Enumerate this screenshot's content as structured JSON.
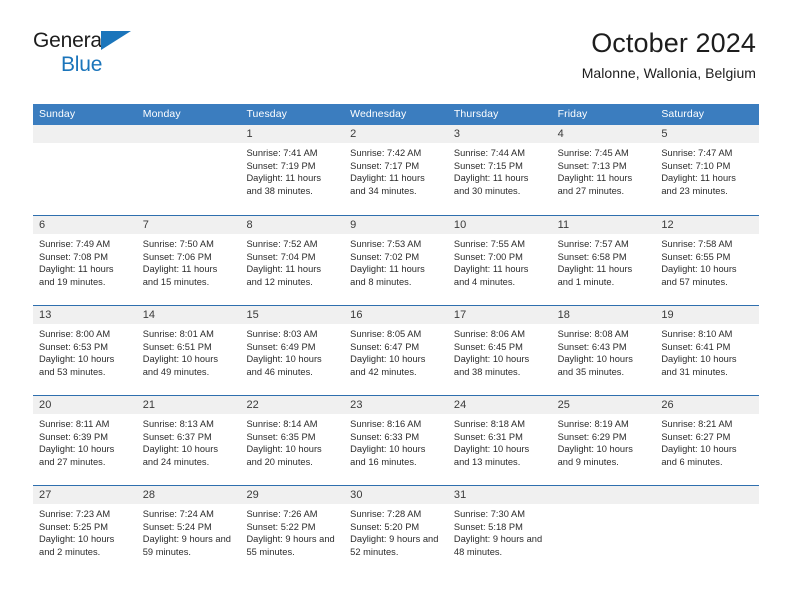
{
  "brand": {
    "name_top": "General",
    "name_bottom": "Blue",
    "accent_color": "#1b75bb"
  },
  "header": {
    "title": "October 2024",
    "subtitle": "Malonne, Wallonia, Belgium"
  },
  "calendar": {
    "header_bg": "#3b7dbf",
    "date_band_bg": "#f0f0f0",
    "weekdays": [
      "Sunday",
      "Monday",
      "Tuesday",
      "Wednesday",
      "Thursday",
      "Friday",
      "Saturday"
    ],
    "weeks": [
      [
        {
          "day": "",
          "empty": true
        },
        {
          "day": "",
          "empty": true
        },
        {
          "day": "1",
          "sunrise": "Sunrise: 7:41 AM",
          "sunset": "Sunset: 7:19 PM",
          "daylight": "Daylight: 11 hours and 38 minutes."
        },
        {
          "day": "2",
          "sunrise": "Sunrise: 7:42 AM",
          "sunset": "Sunset: 7:17 PM",
          "daylight": "Daylight: 11 hours and 34 minutes."
        },
        {
          "day": "3",
          "sunrise": "Sunrise: 7:44 AM",
          "sunset": "Sunset: 7:15 PM",
          "daylight": "Daylight: 11 hours and 30 minutes."
        },
        {
          "day": "4",
          "sunrise": "Sunrise: 7:45 AM",
          "sunset": "Sunset: 7:13 PM",
          "daylight": "Daylight: 11 hours and 27 minutes."
        },
        {
          "day": "5",
          "sunrise": "Sunrise: 7:47 AM",
          "sunset": "Sunset: 7:10 PM",
          "daylight": "Daylight: 11 hours and 23 minutes."
        }
      ],
      [
        {
          "day": "6",
          "sunrise": "Sunrise: 7:49 AM",
          "sunset": "Sunset: 7:08 PM",
          "daylight": "Daylight: 11 hours and 19 minutes."
        },
        {
          "day": "7",
          "sunrise": "Sunrise: 7:50 AM",
          "sunset": "Sunset: 7:06 PM",
          "daylight": "Daylight: 11 hours and 15 minutes."
        },
        {
          "day": "8",
          "sunrise": "Sunrise: 7:52 AM",
          "sunset": "Sunset: 7:04 PM",
          "daylight": "Daylight: 11 hours and 12 minutes."
        },
        {
          "day": "9",
          "sunrise": "Sunrise: 7:53 AM",
          "sunset": "Sunset: 7:02 PM",
          "daylight": "Daylight: 11 hours and 8 minutes."
        },
        {
          "day": "10",
          "sunrise": "Sunrise: 7:55 AM",
          "sunset": "Sunset: 7:00 PM",
          "daylight": "Daylight: 11 hours and 4 minutes."
        },
        {
          "day": "11",
          "sunrise": "Sunrise: 7:57 AM",
          "sunset": "Sunset: 6:58 PM",
          "daylight": "Daylight: 11 hours and 1 minute."
        },
        {
          "day": "12",
          "sunrise": "Sunrise: 7:58 AM",
          "sunset": "Sunset: 6:55 PM",
          "daylight": "Daylight: 10 hours and 57 minutes."
        }
      ],
      [
        {
          "day": "13",
          "sunrise": "Sunrise: 8:00 AM",
          "sunset": "Sunset: 6:53 PM",
          "daylight": "Daylight: 10 hours and 53 minutes."
        },
        {
          "day": "14",
          "sunrise": "Sunrise: 8:01 AM",
          "sunset": "Sunset: 6:51 PM",
          "daylight": "Daylight: 10 hours and 49 minutes."
        },
        {
          "day": "15",
          "sunrise": "Sunrise: 8:03 AM",
          "sunset": "Sunset: 6:49 PM",
          "daylight": "Daylight: 10 hours and 46 minutes."
        },
        {
          "day": "16",
          "sunrise": "Sunrise: 8:05 AM",
          "sunset": "Sunset: 6:47 PM",
          "daylight": "Daylight: 10 hours and 42 minutes."
        },
        {
          "day": "17",
          "sunrise": "Sunrise: 8:06 AM",
          "sunset": "Sunset: 6:45 PM",
          "daylight": "Daylight: 10 hours and 38 minutes."
        },
        {
          "day": "18",
          "sunrise": "Sunrise: 8:08 AM",
          "sunset": "Sunset: 6:43 PM",
          "daylight": "Daylight: 10 hours and 35 minutes."
        },
        {
          "day": "19",
          "sunrise": "Sunrise: 8:10 AM",
          "sunset": "Sunset: 6:41 PM",
          "daylight": "Daylight: 10 hours and 31 minutes."
        }
      ],
      [
        {
          "day": "20",
          "sunrise": "Sunrise: 8:11 AM",
          "sunset": "Sunset: 6:39 PM",
          "daylight": "Daylight: 10 hours and 27 minutes."
        },
        {
          "day": "21",
          "sunrise": "Sunrise: 8:13 AM",
          "sunset": "Sunset: 6:37 PM",
          "daylight": "Daylight: 10 hours and 24 minutes."
        },
        {
          "day": "22",
          "sunrise": "Sunrise: 8:14 AM",
          "sunset": "Sunset: 6:35 PM",
          "daylight": "Daylight: 10 hours and 20 minutes."
        },
        {
          "day": "23",
          "sunrise": "Sunrise: 8:16 AM",
          "sunset": "Sunset: 6:33 PM",
          "daylight": "Daylight: 10 hours and 16 minutes."
        },
        {
          "day": "24",
          "sunrise": "Sunrise: 8:18 AM",
          "sunset": "Sunset: 6:31 PM",
          "daylight": "Daylight: 10 hours and 13 minutes."
        },
        {
          "day": "25",
          "sunrise": "Sunrise: 8:19 AM",
          "sunset": "Sunset: 6:29 PM",
          "daylight": "Daylight: 10 hours and 9 minutes."
        },
        {
          "day": "26",
          "sunrise": "Sunrise: 8:21 AM",
          "sunset": "Sunset: 6:27 PM",
          "daylight": "Daylight: 10 hours and 6 minutes."
        }
      ],
      [
        {
          "day": "27",
          "sunrise": "Sunrise: 7:23 AM",
          "sunset": "Sunset: 5:25 PM",
          "daylight": "Daylight: 10 hours and 2 minutes."
        },
        {
          "day": "28",
          "sunrise": "Sunrise: 7:24 AM",
          "sunset": "Sunset: 5:24 PM",
          "daylight": "Daylight: 9 hours and 59 minutes."
        },
        {
          "day": "29",
          "sunrise": "Sunrise: 7:26 AM",
          "sunset": "Sunset: 5:22 PM",
          "daylight": "Daylight: 9 hours and 55 minutes."
        },
        {
          "day": "30",
          "sunrise": "Sunrise: 7:28 AM",
          "sunset": "Sunset: 5:20 PM",
          "daylight": "Daylight: 9 hours and 52 minutes."
        },
        {
          "day": "31",
          "sunrise": "Sunrise: 7:30 AM",
          "sunset": "Sunset: 5:18 PM",
          "daylight": "Daylight: 9 hours and 48 minutes."
        },
        {
          "day": "",
          "empty": true
        },
        {
          "day": "",
          "empty": true
        }
      ]
    ]
  }
}
